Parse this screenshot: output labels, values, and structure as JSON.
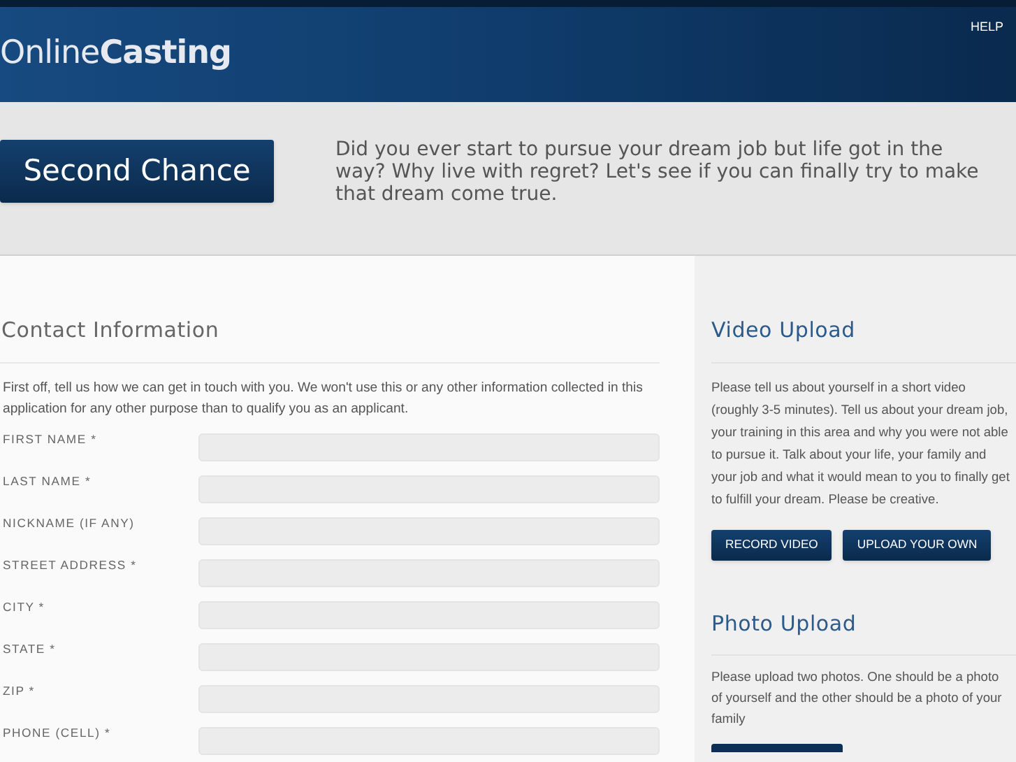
{
  "header": {
    "logo_light": "Online",
    "logo_bold": "Casting",
    "help_link": "HELP"
  },
  "banner": {
    "button": "Second Chance",
    "text": "Did you ever start to pursue your dream job but life got in the way? Why live with regret? Let's see if you can finally try to make that dream come true."
  },
  "contact": {
    "title": "Contact Information",
    "intro": "First off, tell us how we can get in touch with you. We won't use this or any other information collected in this application for any other purpose than to qualify you as an applicant.",
    "fields": [
      {
        "label": "FIRST NAME *"
      },
      {
        "label": "LAST NAME *"
      },
      {
        "label": "NICKNAME (IF ANY)"
      },
      {
        "label": "STREET ADDRESS *"
      },
      {
        "label": "CITY *"
      },
      {
        "label": "STATE *"
      },
      {
        "label": "ZIP *"
      },
      {
        "label": "PHONE (CELL) *"
      }
    ]
  },
  "video_upload": {
    "title": "Video Upload",
    "text": "Please tell us about yourself in a short video (roughly 3-5 minutes). Tell us about your dream job, your training in this area and why you were not able to pursue it. Talk about your life, your family and your job and what it would mean to you to finally get to fulfill your dream. Please be creative.",
    "buttons": [
      "RECORD VIDEO",
      "UPLOAD YOUR OWN"
    ]
  },
  "photo_upload": {
    "title": "Photo Upload",
    "text": "Please upload two photos. One should be a photo of yourself and the other should be a photo of your family"
  }
}
